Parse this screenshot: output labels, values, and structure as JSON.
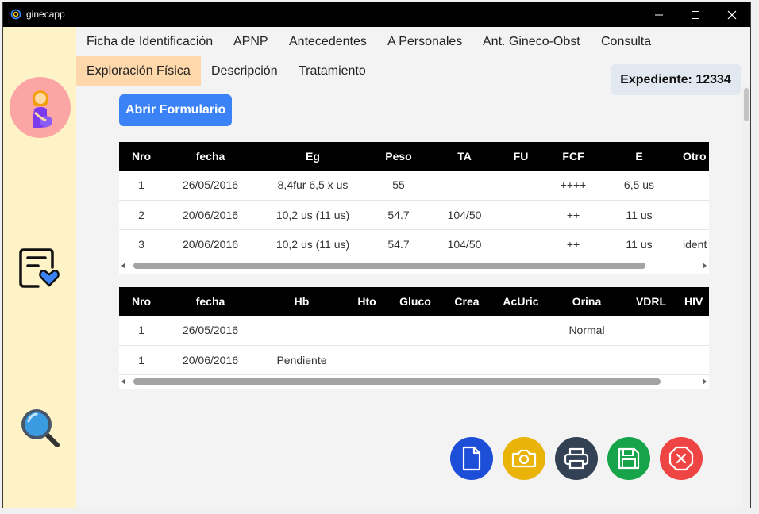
{
  "window": {
    "title": "ginecapp"
  },
  "tabs": [
    {
      "label": "Ficha de Identificación"
    },
    {
      "label": "APNP"
    },
    {
      "label": "Antecedentes"
    },
    {
      "label": "A Personales"
    },
    {
      "label": "Ant. Gineco-Obst"
    },
    {
      "label": "Consulta"
    },
    {
      "label": "Exploración Física",
      "active": true
    },
    {
      "label": "Descripción"
    },
    {
      "label": "Tratamiento"
    }
  ],
  "expediente": {
    "text": "Expediente: 12334"
  },
  "actions": {
    "open_form": "Abrir Formulario"
  },
  "table1": {
    "headers": [
      "Nro",
      "fecha",
      "Eg",
      "Peso",
      "TA",
      "FU",
      "FCF",
      "E",
      "Otro"
    ],
    "rows": [
      [
        "1",
        "26/05/2016",
        "8,4fur 6,5 x us",
        "55",
        "",
        "",
        "++++",
        "6,5 us",
        ""
      ],
      [
        "2",
        "20/06/2016",
        "10,2 us (11 us)",
        "54.7",
        "104/50",
        "",
        "++",
        "11 us",
        ""
      ],
      [
        "3",
        "20/06/2016",
        "10,2 us (11 us)",
        "54.7",
        "104/50",
        "",
        "++",
        "11 us",
        "ident"
      ]
    ]
  },
  "table2": {
    "headers": [
      "Nro",
      "fecha",
      "Hb",
      "Hto",
      "Gluco",
      "Crea",
      "AcUric",
      "Orina",
      "VDRL",
      "HIV"
    ],
    "rows": [
      [
        "1",
        "26/05/2016",
        "",
        "",
        "",
        "",
        "",
        "Normal",
        "",
        ""
      ],
      [
        "1",
        "20/06/2016",
        "Pendiente",
        "",
        "",
        "",
        "",
        "",
        "",
        ""
      ]
    ]
  },
  "fab_buttons": [
    {
      "name": "new-document-button",
      "icon": "document-icon",
      "color": "#1d4ed8"
    },
    {
      "name": "camera-button",
      "icon": "camera-icon",
      "color": "#eab308"
    },
    {
      "name": "print-button",
      "icon": "printer-icon",
      "color": "#334155"
    },
    {
      "name": "save-button",
      "icon": "floppy-disk-icon",
      "color": "#16a34a"
    },
    {
      "name": "cancel-button",
      "icon": "close-octagon-icon",
      "color": "#ef4444"
    }
  ],
  "sidebar": {
    "items": [
      {
        "icon": "pregnant-woman-icon"
      },
      {
        "icon": "medical-record-heart-icon"
      },
      {
        "icon": "magnifier-icon"
      }
    ]
  }
}
